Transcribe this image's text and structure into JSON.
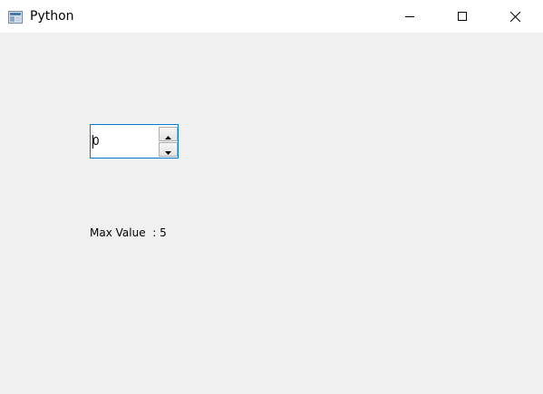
{
  "window": {
    "title": "Python",
    "icons": {
      "app": "python-app-icon",
      "minimize": "minimize-icon",
      "maximize": "maximize-icon",
      "close": "close-icon"
    }
  },
  "spinbox": {
    "value": "0",
    "up_icon": "arrow-up-icon",
    "down_icon": "arrow-down-icon",
    "focus_color": "#0078d7"
  },
  "label": {
    "text": "Max Value  : 5"
  },
  "colors": {
    "background": "#f0f0f0",
    "titlebar": "#ffffff"
  }
}
